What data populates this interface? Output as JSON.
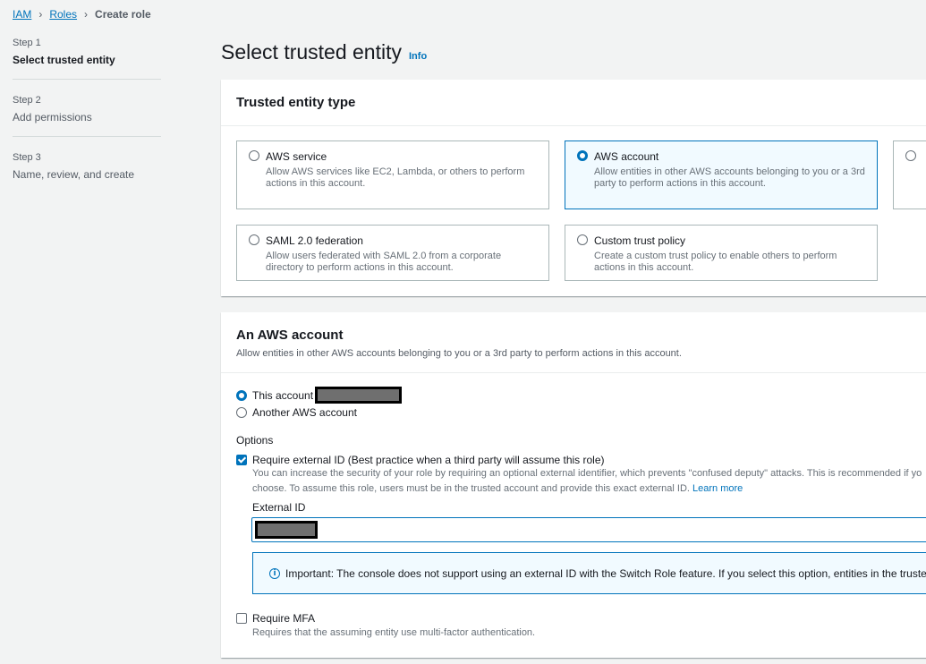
{
  "breadcrumb": {
    "items": [
      "IAM",
      "Roles"
    ],
    "current": "Create role"
  },
  "steps": [
    {
      "num": "Step 1",
      "title": "Select trusted entity"
    },
    {
      "num": "Step 2",
      "title": "Add permissions"
    },
    {
      "num": "Step 3",
      "title": "Name, review, and create"
    }
  ],
  "page": {
    "title": "Select trusted entity",
    "info": "Info"
  },
  "trusted_entity": {
    "heading": "Trusted entity type",
    "options": [
      {
        "title": "AWS service",
        "desc": "Allow AWS services like EC2, Lambda, or others to perform actions in this account."
      },
      {
        "title": "AWS account",
        "desc": "Allow entities in other AWS accounts belonging to you or a 3rd party to perform actions in this account."
      },
      {
        "title": "SAML 2.0 federation",
        "desc": "Allow users federated with SAML 2.0 from a corporate directory to perform actions in this account."
      },
      {
        "title": "Custom trust policy",
        "desc": "Create a custom trust policy to enable others to perform actions in this account."
      }
    ],
    "selected": "AWS account"
  },
  "aws_account": {
    "heading": "An AWS account",
    "desc": "Allow entities in other AWS accounts belonging to you or a 3rd party to perform actions in this account.",
    "this_account": "This account",
    "another_account": "Another AWS account",
    "options_label": "Options",
    "require_external_id": "Require external ID (Best practice when a third party will assume this role)",
    "external_id_desc_1": "You can increase the security of your role by requiring an optional external identifier, which prevents \"confused deputy\" attacks. This is recommended if yo",
    "external_id_desc_2": "choose. To assume this role, users must be in the trusted account and provide this exact external ID.",
    "learn_more": "Learn more",
    "external_id_label": "External ID",
    "alert": "Important: The console does not support using an external ID with the Switch Role feature. If you select this option, entities in the truste",
    "require_mfa": "Require MFA",
    "require_mfa_desc": "Requires that the assuming entity use multi-factor authentication."
  },
  "colors": {
    "accent": "#0073bb",
    "selected_bg": "#f1faff"
  }
}
